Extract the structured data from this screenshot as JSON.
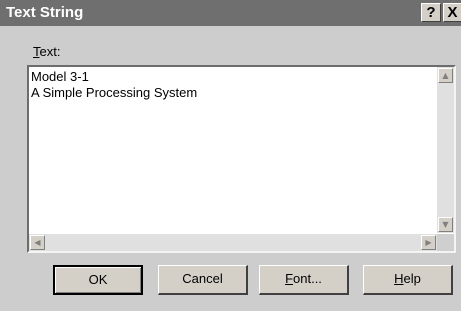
{
  "window": {
    "title": "Text String",
    "help_button": "?",
    "close_button": "X"
  },
  "field": {
    "label_mnemonic": "T",
    "label_rest": "ext:",
    "value": "Model 3-1\nA Simple Processing System"
  },
  "buttons": {
    "ok": "OK",
    "cancel": "Cancel",
    "font_mnemonic": "F",
    "font_rest": "ont...",
    "help_mnemonic": "H",
    "help_rest": "elp"
  },
  "icons": {
    "scroll_up": "up-arrow",
    "scroll_down": "down-arrow",
    "scroll_left": "left-arrow",
    "scroll_right": "right-arrow"
  }
}
